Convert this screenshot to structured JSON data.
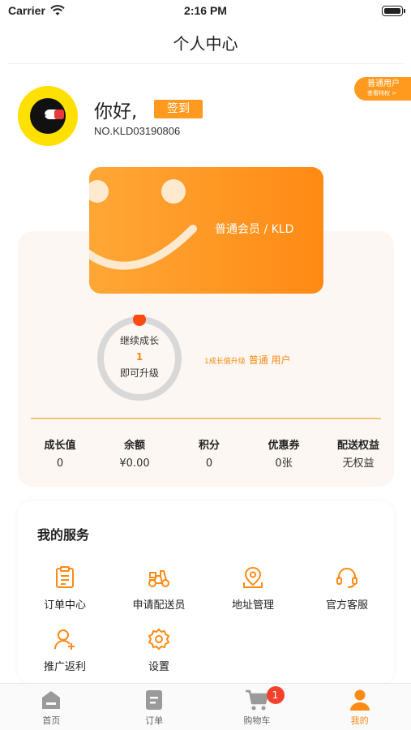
{
  "status_bar": {
    "carrier": "Carrier",
    "time": "2:16 PM"
  },
  "nav": {
    "title": "个人中心"
  },
  "user": {
    "greeting": "你好,",
    "signin_label": "签到",
    "number": "NO.KLD03190806",
    "level_badge": {
      "title": "普通用户",
      "link": "查看特权 >"
    }
  },
  "member_card": {
    "label": "普通会员 / KLD"
  },
  "growth": {
    "line1": "继续成长",
    "value": "1",
    "line2": "即可升级",
    "progress": 0.0,
    "upgrade_prefix": "1成长值升级",
    "upgrade_level": "普通 用户"
  },
  "stats": [
    {
      "label": "成长值",
      "value": "0"
    },
    {
      "label": "余额",
      "value": "¥0.00"
    },
    {
      "label": "积分",
      "value": "0"
    },
    {
      "label": "优惠券",
      "value": "0张"
    },
    {
      "label": "配送权益",
      "value": "无权益"
    }
  ],
  "services": {
    "title": "我的服务",
    "items": [
      {
        "label": "订单中心",
        "icon": "clipboard-icon"
      },
      {
        "label": "申请配送员",
        "icon": "scooter-icon"
      },
      {
        "label": "地址管理",
        "icon": "location-icon"
      },
      {
        "label": "官方客服",
        "icon": "headset-icon"
      },
      {
        "label": "推广返利",
        "icon": "user-plus-icon"
      },
      {
        "label": "设置",
        "icon": "gear-icon"
      }
    ]
  },
  "tabbar": {
    "items": [
      {
        "label": "首页",
        "icon": "home-icon"
      },
      {
        "label": "订单",
        "icon": "order-icon"
      },
      {
        "label": "购物车",
        "icon": "cart-icon",
        "badge": "1"
      },
      {
        "label": "我的",
        "icon": "profile-icon",
        "active": true
      }
    ]
  },
  "colors": {
    "accent": "#ff8a14",
    "panel": "#fcf7f2",
    "badge": "#f4412b",
    "avatar_bg": "#ffe000"
  }
}
